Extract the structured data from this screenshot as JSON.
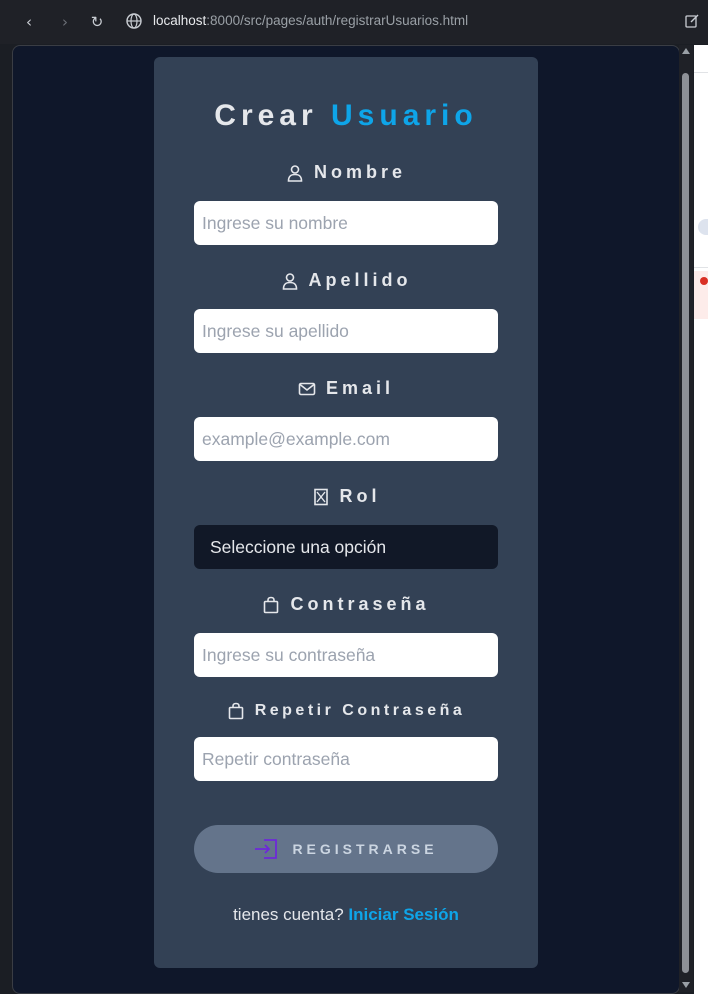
{
  "browser": {
    "url_host": "localhost",
    "url_path": ":8000/src/pages/auth/registrarUsuarios.html"
  },
  "form": {
    "title_main": "Crear",
    "title_accent": "Usuario",
    "fields": {
      "nombre": {
        "label": "Nombre",
        "placeholder": "Ingrese su nombre",
        "icon": "user-icon"
      },
      "apellido": {
        "label": "Apellido",
        "placeholder": "Ingrese su apellido",
        "icon": "user-icon"
      },
      "email": {
        "label": "Email",
        "placeholder": "example@example.com",
        "icon": "envelope-icon"
      },
      "rol": {
        "label": "Rol",
        "selected": "Seleccione una opción",
        "icon": "badge-icon"
      },
      "password": {
        "label": "Contraseña",
        "placeholder": "Ingrese su contraseña",
        "icon": "bag-icon"
      },
      "password_repeat": {
        "label": "Repetir Contraseña",
        "placeholder": "Repetir contraseña",
        "icon": "bag-icon"
      }
    },
    "submit_label": "REGISTRARSE",
    "footer_text": "tienes cuenta?",
    "footer_link": "Iniciar Sesión"
  },
  "colors": {
    "page_bg": "#0f172a",
    "card_bg": "#334155",
    "accent": "#0ea5e9",
    "button_bg": "#64748b",
    "button_icon": "#6d28d9"
  }
}
